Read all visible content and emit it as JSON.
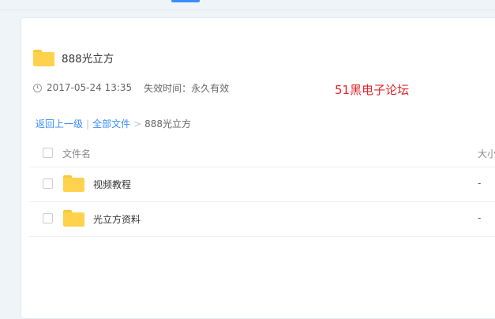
{
  "share": {
    "title": "888光立方",
    "date": "2017-05-24 13:35",
    "expiry": "失效时间：永久有效"
  },
  "watermark": "51黑电子论坛",
  "breadcrumb": {
    "back": "返回上一级",
    "all_files": "全部文件",
    "separator_1": "|",
    "separator_2": ">",
    "current": "888光立方"
  },
  "list": {
    "header_name": "文件名",
    "header_size": "大小",
    "rows": [
      {
        "name": "视频教程",
        "size": "-"
      },
      {
        "name": "光立方资料",
        "size": "-"
      }
    ]
  },
  "colors": {
    "accent": "#3b8cff",
    "folder": "#ffd24d",
    "watermark": "#e2242a"
  }
}
